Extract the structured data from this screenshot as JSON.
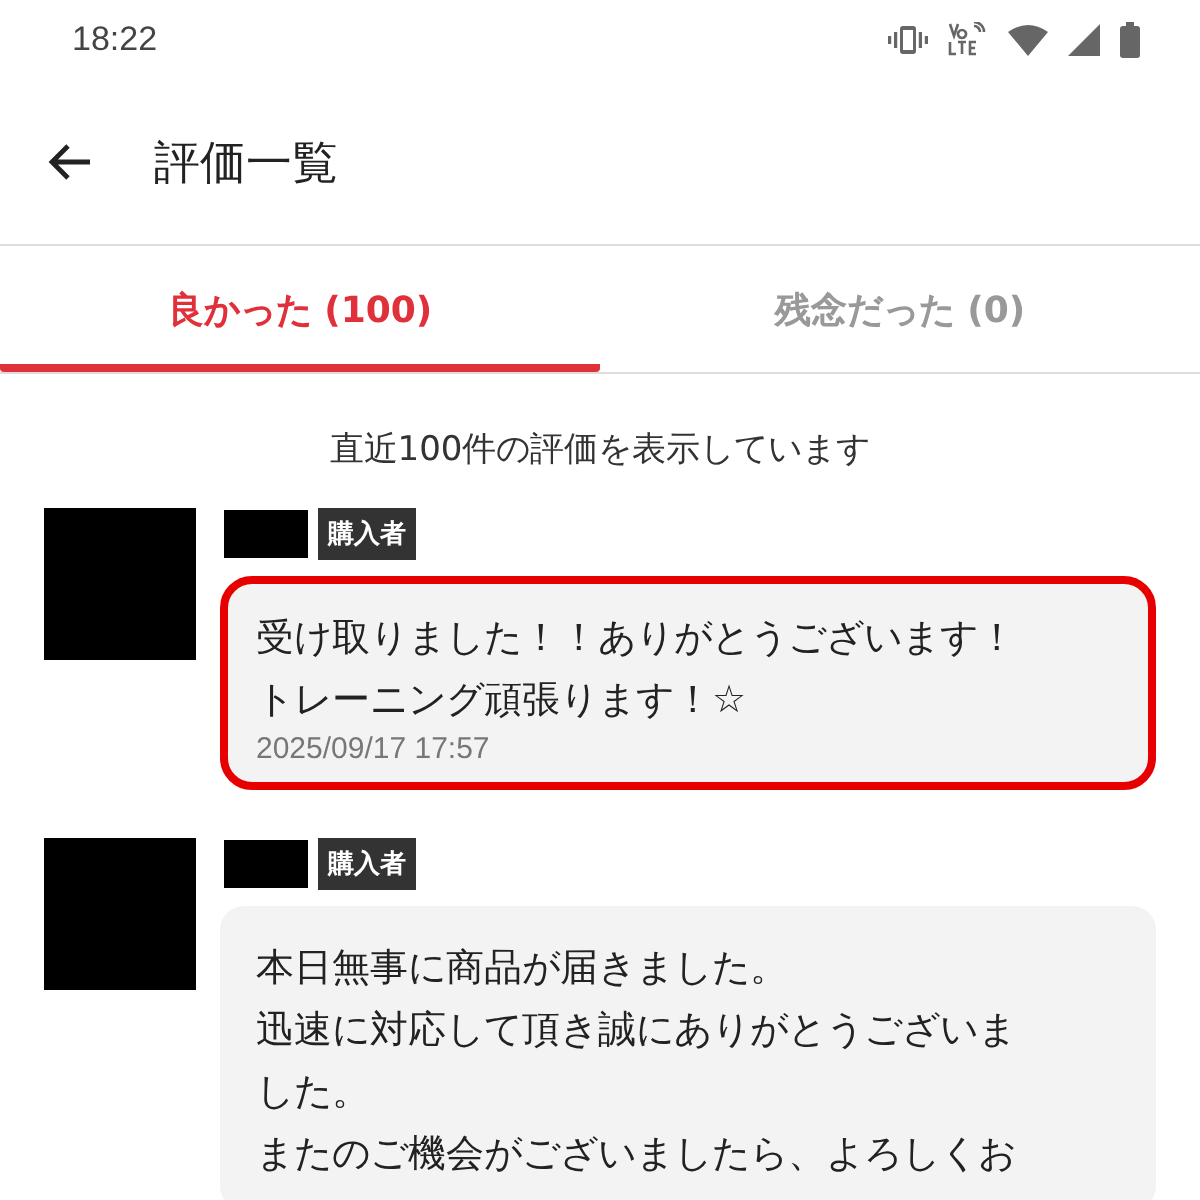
{
  "status_bar": {
    "time": "18:22"
  },
  "header": {
    "title": "評価一覧"
  },
  "tabs": [
    {
      "label": "良かった (100)",
      "selected": true
    },
    {
      "label": "残念だった (0)",
      "selected": false
    }
  ],
  "notice": "直近100件の評価を表示しています",
  "reviews": [
    {
      "badge": "購入者",
      "lines": [
        "受け取りました！！ありがとうございます！",
        "トレーニング頑張ります！☆"
      ],
      "date": "2025/09/17 17:57",
      "highlighted": true
    },
    {
      "badge": "購入者",
      "lines": [
        "本日無事に商品が届きました。",
        "迅速に対応して頂き誠にありがとうございま",
        "した。",
        "またのご機会がございましたら、よろしくお"
      ],
      "highlighted": false
    }
  ]
}
